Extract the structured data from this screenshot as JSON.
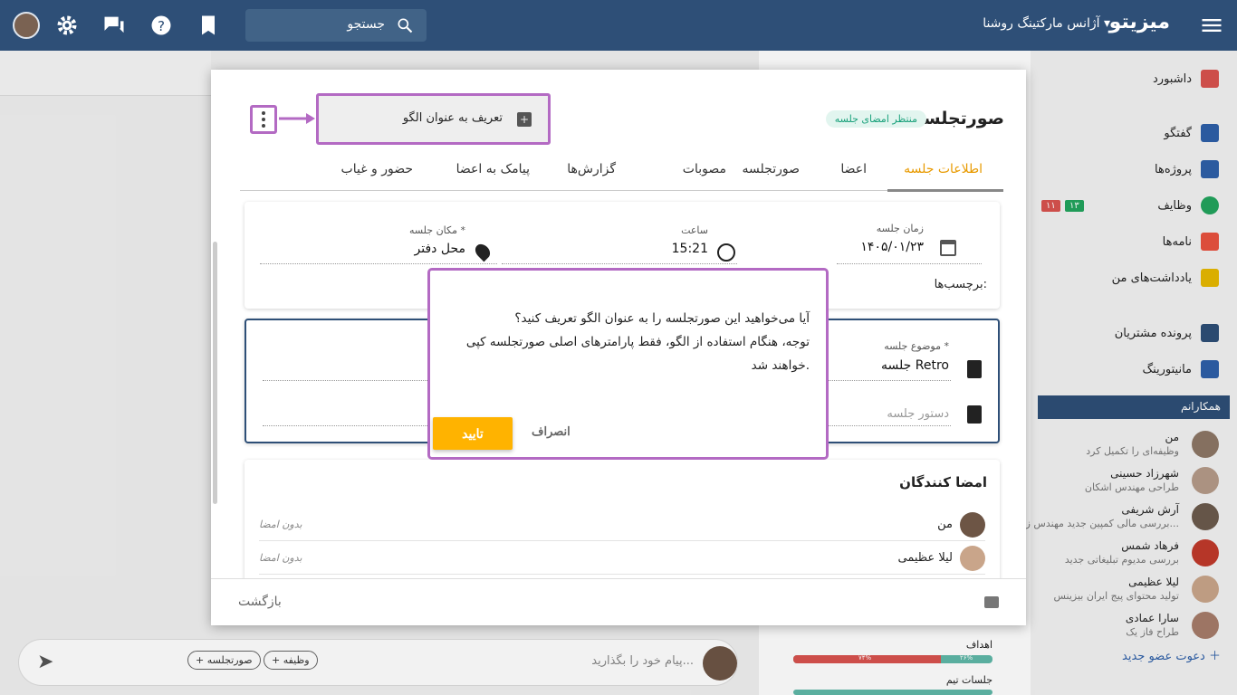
{
  "topbar": {
    "brand": "میزیتو",
    "org": "آژانس مارکتینگ روشنا",
    "search_placeholder": "جستجو"
  },
  "sidebar": {
    "items": [
      {
        "label": "داشبورد",
        "color": "#d9534f"
      },
      {
        "label": "گفتگو",
        "color": "#2e5fa8"
      },
      {
        "label": "پروژه‌ها",
        "color": "#2e5fa8"
      },
      {
        "label": "وظایف",
        "color": "#22a45d"
      },
      {
        "label": "نامه‌ها",
        "color": "#e8523f"
      },
      {
        "label": "یادداشت‌های من",
        "color": "#e6b800"
      },
      {
        "label": "پرونده مشتریان",
        "color": "#2e4f77"
      },
      {
        "label": "مانیتورینگ",
        "color": "#2e5fa8"
      }
    ],
    "task_badges": [
      "۱۳",
      "۱۱"
    ],
    "colleagues_title": "همکارانم",
    "colleagues": [
      {
        "name": "من",
        "sub": "وظیفه‌ای را تکمیل کرد"
      },
      {
        "name": "شهرزاد حسینی",
        "sub": "طراحی مهندس اشکان"
      },
      {
        "name": "آرش شریفی",
        "sub": "بررسی مالی کمپین جدید مهندس ز..."
      },
      {
        "name": "فرهاد شمس",
        "sub": "بررسی مدیوم تبلیغاتی جدید"
      },
      {
        "name": "لیلا عظیمی",
        "sub": "تولید محتوای پیج ایران بیزینس"
      },
      {
        "name": "سارا عمادی",
        "sub": "طراح فاز یک"
      }
    ],
    "invite": "دعوت عضو جدید"
  },
  "modal": {
    "title": "صورتجلسه",
    "status": "منتظر امضای جلسه",
    "menu_item": "تعریف به عنوان الگو",
    "tabs": [
      "اطلاعات جلسه",
      "اعضا",
      "صورتجلسه",
      "مصوبات",
      "گزارش‌ها",
      "پیامک به اعضا",
      "حضور و غیاب"
    ],
    "date_label": "زمان جلسه",
    "date_value": "۱۴۰۵/۰۱/۲۳",
    "time_label": "ساعت",
    "time_value": "15:21",
    "place_label": "مکان جلسه *",
    "place_value": "محل دفتر",
    "tags_label": "برچسب‌ها:",
    "subject_label": "موضوع جلسه *",
    "subject_value": "جلسه Retro",
    "agenda_placeholder": "دستور جلسه",
    "signers_title": "امضا کنندگان",
    "signers": [
      {
        "name": "من",
        "status": "بدون امضا"
      },
      {
        "name": "لیلا عظیمی",
        "status": "بدون امضا"
      }
    ],
    "back": "بازگشت"
  },
  "dialog": {
    "line1": "آیا می‌خواهید این صورتجلسه را به عنوان الگو تعریف کنید؟",
    "line2": "توجه، هنگام استفاده از الگو، فقط پارامترهای اصلی صورتجلسه کپی",
    "line3": "خواهند شد.",
    "confirm": "تایید",
    "cancel": "انصراف"
  },
  "chat": {
    "placeholder": "پیام خود را بگذارید...",
    "chip1": "+ وظیفه",
    "chip2": "+ صورتجلسه"
  },
  "background_panel": {
    "goals": "اهداف",
    "goals_pct": "۷۴%",
    "goals_pct2": "۲۶%",
    "team": "جلسات تیم"
  }
}
